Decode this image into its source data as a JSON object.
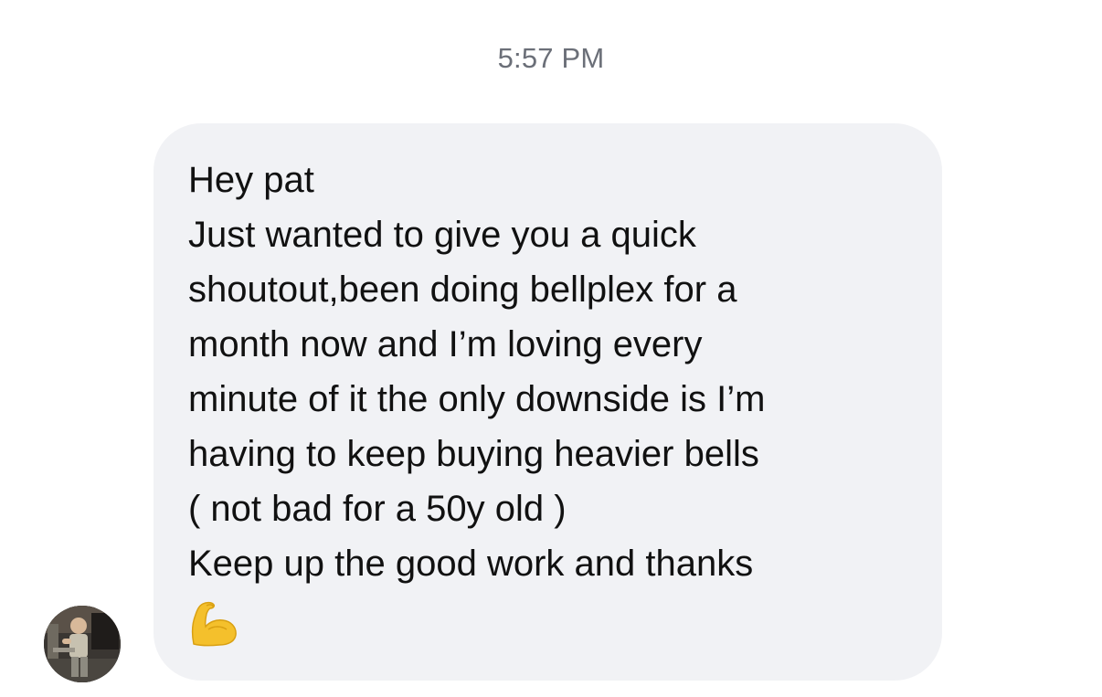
{
  "conversation": {
    "timestamp": "5:57 PM",
    "message": {
      "lines": [
        "Hey pat",
        "Just wanted to give you a quick",
        "shoutout,been doing bellplex for a",
        "month now and I’m loving every",
        "minute of it the only downside is I’m",
        "having to keep buying heavier bells",
        "( not bad for a 50y old )",
        "Keep up the good work and thanks"
      ],
      "emoji": "flexed-biceps-icon"
    },
    "sender": {
      "avatar": "avatar-photo"
    }
  }
}
